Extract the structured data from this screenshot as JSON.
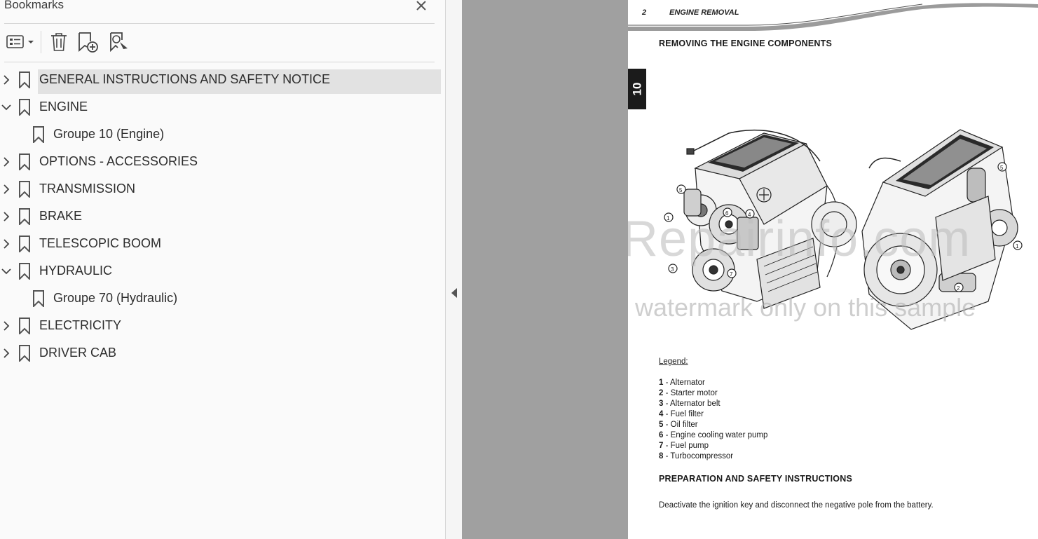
{
  "bookmarks_panel": {
    "title": "Bookmarks",
    "items": [
      {
        "label": "GENERAL INSTRUCTIONS AND SAFETY NOTICE",
        "level": 0,
        "expanded": false,
        "selected": true
      },
      {
        "label": "ENGINE",
        "level": 0,
        "expanded": true,
        "selected": false
      },
      {
        "label": "Groupe 10 (Engine)",
        "level": 1,
        "expanded": null,
        "selected": false
      },
      {
        "label": "OPTIONS - ACCESSORIES",
        "level": 0,
        "expanded": false,
        "selected": false
      },
      {
        "label": "TRANSMISSION",
        "level": 0,
        "expanded": false,
        "selected": false
      },
      {
        "label": "BRAKE",
        "level": 0,
        "expanded": false,
        "selected": false
      },
      {
        "label": "TELESCOPIC BOOM",
        "level": 0,
        "expanded": false,
        "selected": false
      },
      {
        "label": "HYDRAULIC",
        "level": 0,
        "expanded": true,
        "selected": false
      },
      {
        "label": "Groupe 70 (Hydraulic)",
        "level": 1,
        "expanded": null,
        "selected": false
      },
      {
        "label": "ELECTRICITY",
        "level": 0,
        "expanded": false,
        "selected": false
      },
      {
        "label": "DRIVER CAB",
        "level": 0,
        "expanded": false,
        "selected": false
      }
    ]
  },
  "document": {
    "header_number": "2",
    "header_title": "ENGINE REMOVAL",
    "section_title": "REMOVING THE ENGINE COMPONENTS",
    "tab_label": "10",
    "watermark_main": "eRepairinfo.com",
    "watermark_sub": "watermark only on this sample",
    "legend_title": "Legend:",
    "legend": [
      {
        "num": "1",
        "sep": " - ",
        "text": "Alternator"
      },
      {
        "num": "2",
        "sep": " - ",
        "text": "Starter motor"
      },
      {
        "num": "3",
        "sep": " - ",
        "text": "Alternator belt"
      },
      {
        "num": "4",
        "sep": " - ",
        "text": "Fuel filter"
      },
      {
        "num": "5",
        "sep": " - ",
        "text": "Oil filter"
      },
      {
        "num": "6",
        "sep": " - ",
        "text": "Engine cooling water pump"
      },
      {
        "num": "7",
        "sep": " - ",
        "text": "Fuel pump"
      },
      {
        "num": "8",
        "sep": " - ",
        "text": "Turbocompressor"
      }
    ],
    "section2_title": "PREPARATION AND SAFETY INSTRUCTIONS",
    "body_text": "Deactivate the ignition key and disconnect the negative pole from the battery.",
    "callouts_left": [
      "5",
      "1",
      "6",
      "4",
      "7",
      "3"
    ],
    "callouts_right": [
      "5",
      "1",
      "2"
    ]
  }
}
